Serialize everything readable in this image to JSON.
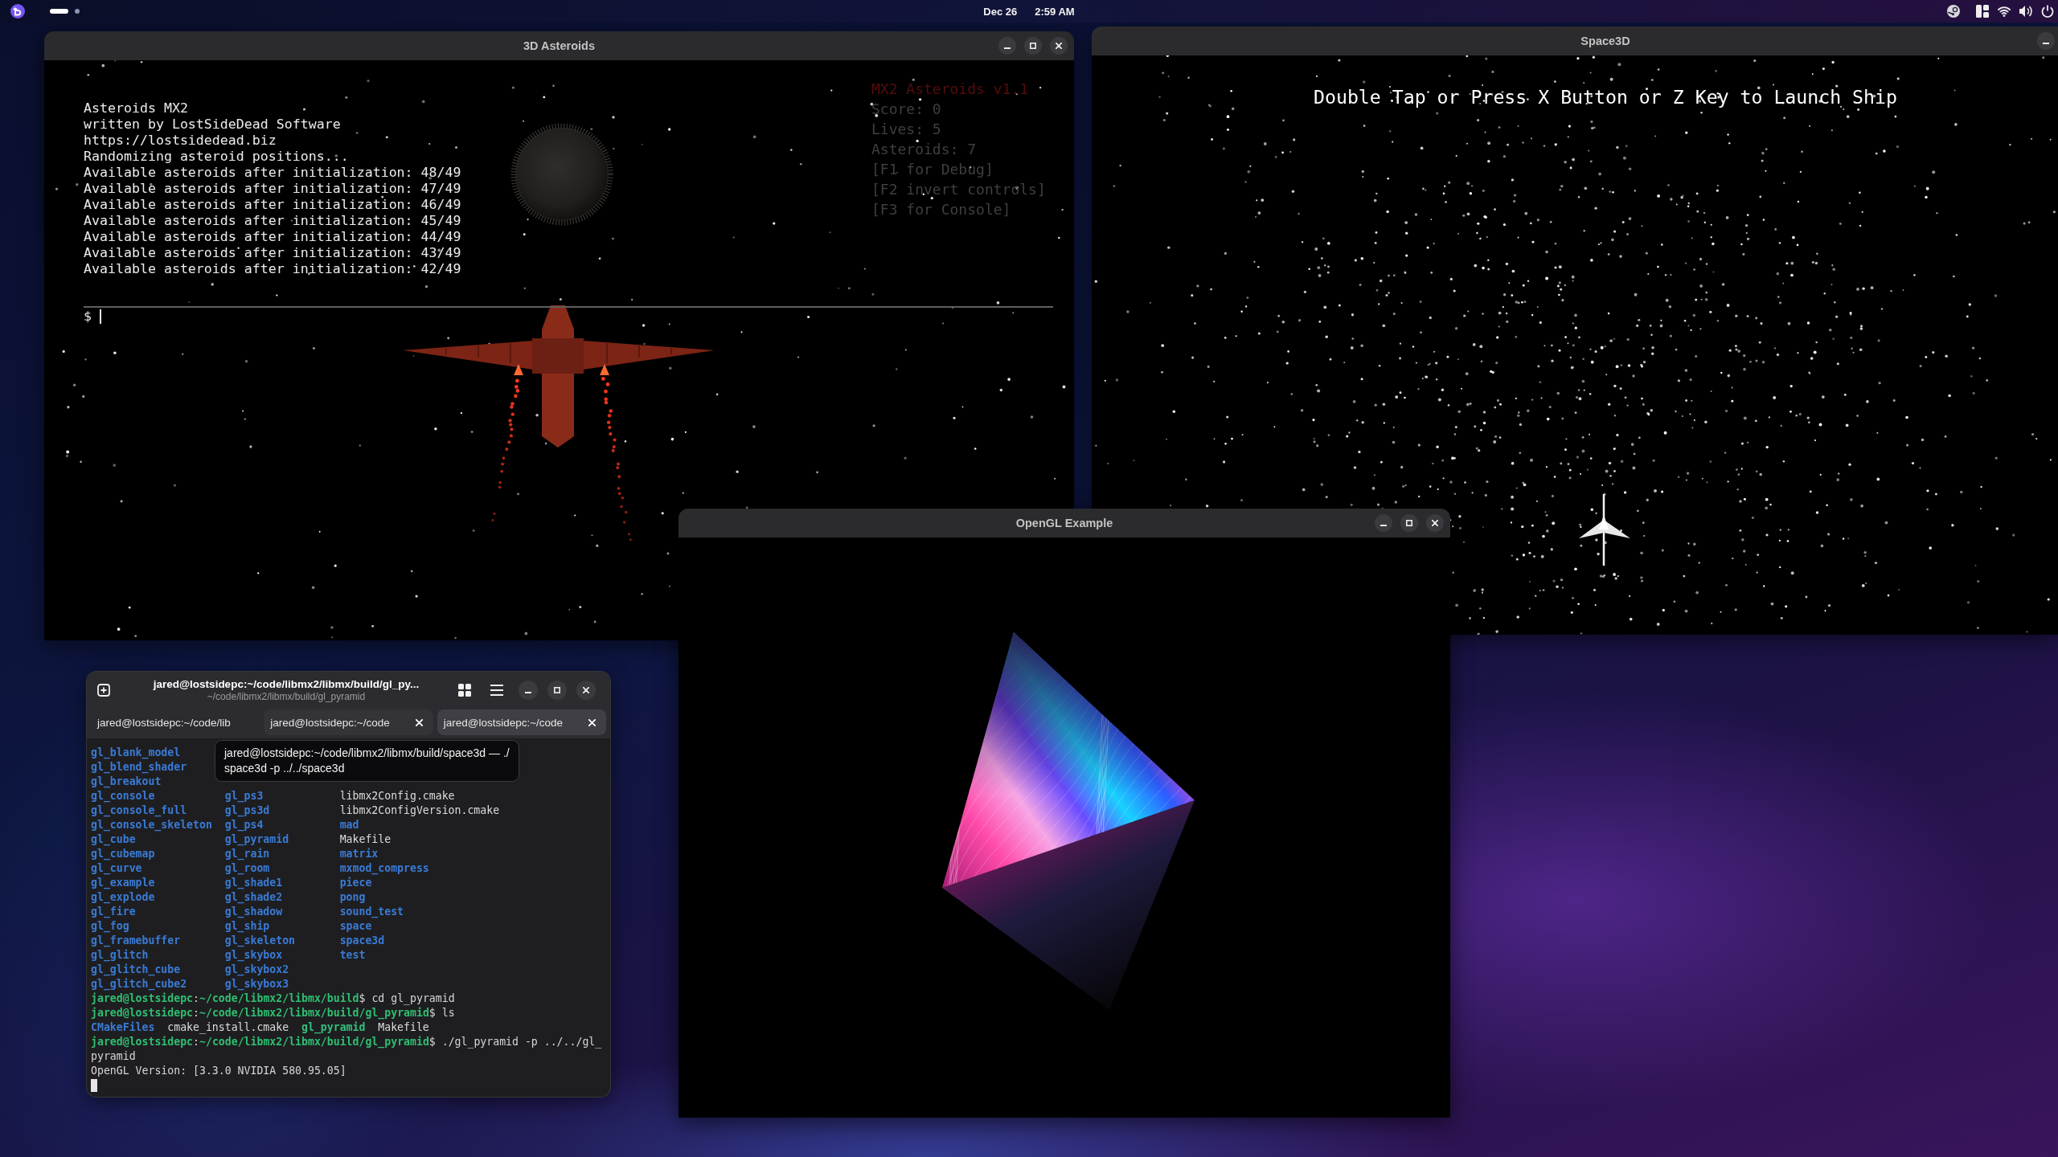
{
  "top_bar": {
    "workspaces": [
      {
        "selected": true
      },
      {
        "selected": false
      }
    ],
    "date": "Dec 26",
    "time": "2:59 AM"
  },
  "asteroids_window": {
    "title": "3D Asteroids",
    "console_lines": [
      "Asteroids MX2",
      "written by LostSideDead Software",
      "https://lostsidedead.biz",
      "Randomizing asteroid positions...",
      "Available asteroids after initialization: 48/49",
      "Available asteroids after initialization: 47/49",
      "Available asteroids after initialization: 46/49",
      "Available asteroids after initialization: 45/49",
      "Available asteroids after initialization: 44/49",
      "Available asteroids after initialization: 43/49",
      "Available asteroids after initialization: 42/49"
    ],
    "hud": [
      {
        "kind": "title",
        "text": "MX2 Asteroids v1.1"
      },
      {
        "kind": "stat",
        "text": "Score: 0"
      },
      {
        "kind": "stat",
        "text": "Lives: 5"
      },
      {
        "kind": "stat",
        "text": "Asteroids: 7"
      },
      {
        "kind": "stat",
        "text": "[F1 for Debug]"
      },
      {
        "kind": "stat",
        "text": "[F2 invert controls]"
      },
      {
        "kind": "stat",
        "text": "[F3 for Console]"
      }
    ],
    "prompt": "$"
  },
  "space3d_window": {
    "title": "Space3D",
    "message": "Double Tap or Press X Button or Z Key to Launch Ship"
  },
  "opengl_window": {
    "title": "OpenGL Example"
  },
  "terminal_window": {
    "title": "jared@lostsidepc:~/code/libmx2/libmx/build/gl_py...",
    "subtitle": "~/code/libmx2/libmx/build/gl_pyramid",
    "tabs": [
      {
        "label": "jared@lostsidepc:~/code/lib",
        "selected": false,
        "hovered": false
      },
      {
        "label": "jared@lostsidepc:~/code",
        "selected": false,
        "hovered": true
      },
      {
        "label": "jared@lostsidepc:~/code",
        "selected": true,
        "hovered": false
      }
    ],
    "tooltip": {
      "lines": [
        "jared@lostsidepc:~/code/libmx2/libmx/build/space3d — ./",
        "space3d -p ../../space3d"
      ]
    },
    "listing": [
      {
        "column_1": {
          "name": "gl_blank_model",
          "kind": "dir"
        }
      },
      {
        "column_1": {
          "name": "gl_blend_shader",
          "kind": "dir"
        }
      },
      {
        "column_1": {
          "name": "gl_breakout",
          "kind": "dir"
        }
      },
      {
        "column_1": {
          "name": "gl_console",
          "kind": "dir"
        },
        "column_2": {
          "name": "gl_ps3",
          "kind": "dir"
        },
        "column_3": {
          "name": "libmx2Config.cmake",
          "kind": "file"
        }
      },
      {
        "column_1": {
          "name": "gl_console_full",
          "kind": "dir"
        },
        "column_2": {
          "name": "gl_ps3d",
          "kind": "dir"
        },
        "column_3": {
          "name": "libmx2ConfigVersion.cmake",
          "kind": "file"
        }
      },
      {
        "column_1": {
          "name": "gl_console_skeleton",
          "kind": "dir"
        },
        "column_2": {
          "name": "gl_ps4",
          "kind": "dir"
        },
        "column_3": {
          "name": "mad",
          "kind": "dir"
        }
      },
      {
        "column_1": {
          "name": "gl_cube",
          "kind": "dir"
        },
        "column_2": {
          "name": "gl_pyramid",
          "kind": "dir"
        },
        "column_3": {
          "name": "Makefile",
          "kind": "file"
        }
      },
      {
        "column_1": {
          "name": "gl_cubemap",
          "kind": "dir"
        },
        "column_2": {
          "name": "gl_rain",
          "kind": "dir"
        },
        "column_3": {
          "name": "matrix",
          "kind": "dir"
        }
      },
      {
        "column_1": {
          "name": "gl_curve",
          "kind": "dir"
        },
        "column_2": {
          "name": "gl_room",
          "kind": "dir"
        },
        "column_3": {
          "name": "mxmod_compress",
          "kind": "dir"
        }
      },
      {
        "column_1": {
          "name": "gl_example",
          "kind": "dir"
        },
        "column_2": {
          "name": "gl_shade1",
          "kind": "dir"
        },
        "column_3": {
          "name": "piece",
          "kind": "dir"
        }
      },
      {
        "column_1": {
          "name": "gl_explode",
          "kind": "dir"
        },
        "column_2": {
          "name": "gl_shade2",
          "kind": "dir"
        },
        "column_3": {
          "name": "pong",
          "kind": "dir"
        }
      },
      {
        "column_1": {
          "name": "gl_fire",
          "kind": "dir"
        },
        "column_2": {
          "name": "gl_shadow",
          "kind": "dir"
        },
        "column_3": {
          "name": "sound_test",
          "kind": "dir"
        }
      },
      {
        "column_1": {
          "name": "gl_fog",
          "kind": "dir"
        },
        "column_2": {
          "name": "gl_ship",
          "kind": "dir"
        },
        "column_3": {
          "name": "space",
          "kind": "dir"
        }
      },
      {
        "column_1": {
          "name": "gl_framebuffer",
          "kind": "dir"
        },
        "column_2": {
          "name": "gl_skeleton",
          "kind": "dir"
        },
        "column_3": {
          "name": "space3d",
          "kind": "dir"
        }
      },
      {
        "column_1": {
          "name": "gl_glitch",
          "kind": "dir"
        },
        "column_2": {
          "name": "gl_skybox",
          "kind": "dir"
        },
        "column_3": {
          "name": "test",
          "kind": "dir"
        }
      },
      {
        "column_1": {
          "name": "gl_glitch_cube",
          "kind": "dir"
        },
        "column_2": {
          "name": "gl_skybox2",
          "kind": "dir"
        }
      },
      {
        "column_1": {
          "name": "gl_glitch_cube2",
          "kind": "dir"
        },
        "column_2": {
          "name": "gl_skybox3",
          "kind": "dir"
        }
      }
    ],
    "lines": [
      {
        "kind": "prompt",
        "text": "**jared@lostsidepc**:**~/code/libmx2/libmx/build**$ cd gl_pyramid"
      },
      {
        "kind": "prompt",
        "text": "**jared@lostsidepc**:**~/code/libmx2/libmx/build/gl_pyramid**$ ls"
      },
      {
        "kind": "files",
        "items": [
          {
            "name": "CMakeFiles",
            "kind": "dir"
          },
          {
            "name": "cmake_install.cmake",
            "kind": "file"
          },
          {
            "name": "gl_pyramid",
            "kind": "exec"
          },
          {
            "name": "Makefile",
            "kind": "file"
          }
        ]
      },
      {
        "kind": "prompt",
        "text": "**jared@lostsidepc**:**~/code/libmx2/libmx/build/gl_pyramid**$ ./gl_pyramid -p ../../gl_"
      },
      {
        "kind": "output",
        "text": "pyramid"
      },
      {
        "kind": "output",
        "text": "OpenGL Version: [3.3.0 NVIDIA 580.95.05]"
      },
      {
        "kind": "cursor"
      }
    ]
  }
}
